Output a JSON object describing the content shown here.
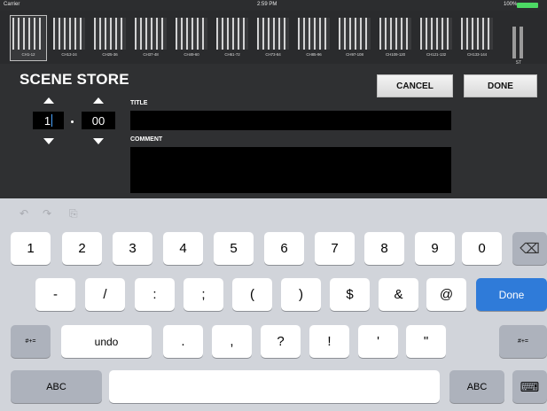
{
  "status_bar": {
    "carrier": "Carrier",
    "time": "2:59 PM",
    "battery": "100%"
  },
  "channel_strips": [
    {
      "label": "CH1-12",
      "selected": true
    },
    {
      "label": "CH13-24"
    },
    {
      "label": "CH25-36"
    },
    {
      "label": "CH37-48"
    },
    {
      "label": "CH49-60"
    },
    {
      "label": "CH61-72"
    },
    {
      "label": "CH73-84"
    },
    {
      "label": "CH85-96"
    },
    {
      "label": "CH97-108"
    },
    {
      "label": "CH109-120"
    },
    {
      "label": "CH121-132"
    },
    {
      "label": "CH133-144"
    }
  ],
  "stereo_strip_label": "ST",
  "scene": {
    "title": "SCENE STORE",
    "cancel_label": "CANCEL",
    "done_label": "DONE",
    "number_major": "1",
    "number_separator": ".",
    "number_minor": "00",
    "title_label": "TITLE",
    "title_value": "",
    "comment_label": "COMMENT",
    "comment_value": ""
  },
  "keyboard": {
    "tools": {
      "undo": "↶",
      "redo": "↷",
      "paste": "⎘"
    },
    "row1": [
      "1",
      "2",
      "3",
      "4",
      "5",
      "6",
      "7",
      "8",
      "9",
      "0"
    ],
    "delete": "⌫",
    "row2": [
      "-",
      "/",
      ":",
      ";",
      "(",
      ")",
      "$",
      "&",
      "@"
    ],
    "done": "Done",
    "row3_left_mode": "#+=",
    "row3_undo": "undo",
    "row3": [
      ".",
      ",",
      "?",
      "!",
      "'",
      "\""
    ],
    "row3_right_mode": "#+=",
    "abc_left": "ABC",
    "abc_right": "ABC",
    "dismiss": "⌨"
  }
}
